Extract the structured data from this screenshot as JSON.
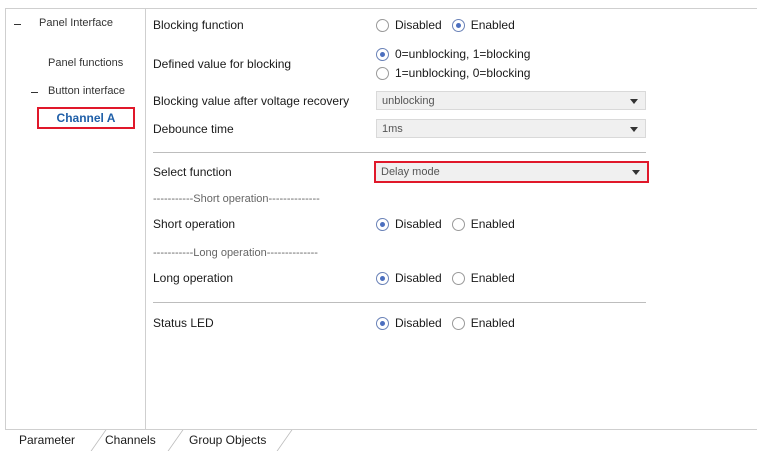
{
  "tree": {
    "panel_interface": "Panel Interface",
    "panel_functions": "Panel functions",
    "button_interface": "Button interface",
    "channel_a": "Channel A"
  },
  "params": {
    "blocking_function": {
      "label": "Blocking function",
      "options": [
        "Disabled",
        "Enabled"
      ],
      "selected": "Enabled"
    },
    "defined_value": {
      "label": "Defined value for blocking",
      "options": [
        "0=unblocking, 1=blocking",
        "1=unblocking, 0=blocking"
      ],
      "selected": "0=unblocking, 1=blocking"
    },
    "blocking_after_recovery": {
      "label": "Blocking value after voltage recovery",
      "value": "unblocking"
    },
    "debounce_time": {
      "label": "Debounce time",
      "value": "1ms"
    },
    "select_function": {
      "label": "Select function",
      "value": "Delay mode"
    },
    "short_sep": "-----------Short operation--------------",
    "short_operation": {
      "label": "Short operation",
      "options": [
        "Disabled",
        "Enabled"
      ],
      "selected": "Disabled"
    },
    "long_sep": "-----------Long operation--------------",
    "long_operation": {
      "label": "Long operation",
      "options": [
        "Disabled",
        "Enabled"
      ],
      "selected": "Disabled"
    },
    "status_led": {
      "label": "Status LED",
      "options": [
        "Disabled",
        "Enabled"
      ],
      "selected": "Disabled"
    }
  },
  "tabs": [
    "Parameter",
    "Channels",
    "Group Objects"
  ],
  "colors": {
    "highlight": "#e0182a",
    "selected_node_text": "#1f5fa8",
    "radio_dot": "#4c6fbf"
  }
}
